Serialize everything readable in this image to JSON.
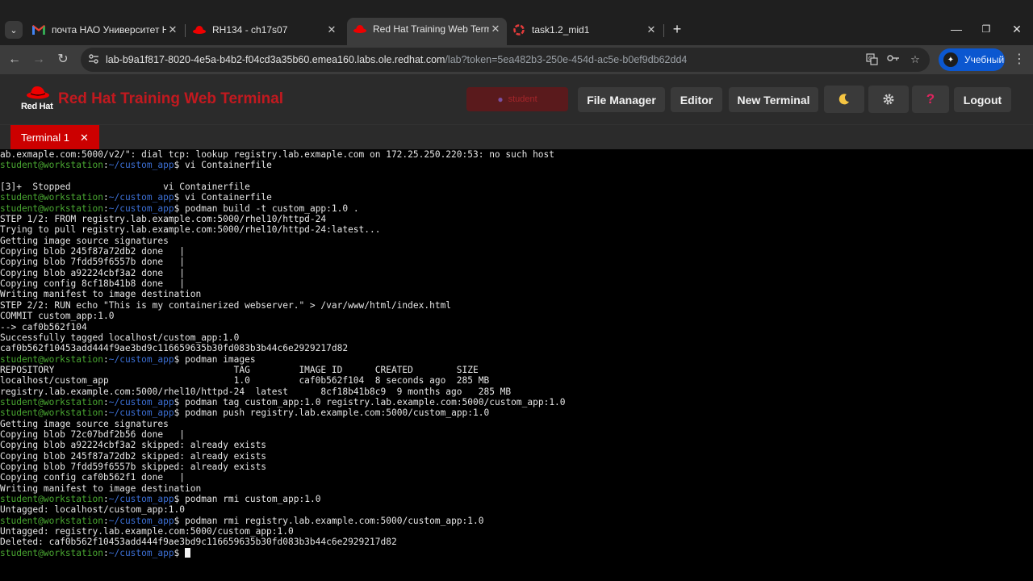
{
  "browser": {
    "tabs": [
      {
        "title": "почта НАО Университет НАРХ",
        "icon": "gmail-icon",
        "active": false
      },
      {
        "title": "RH134 - ch17s07",
        "icon": "redhat-hat-icon",
        "active": false
      },
      {
        "title": "Red Hat Training Web Terminal",
        "icon": "redhat-hat-icon",
        "active": true
      },
      {
        "title": "task1.2_mid1",
        "icon": "openshift-icon",
        "active": false
      }
    ],
    "url_host": "lab-b9a1f817-8020-4e5a-b4b2-f04cd3a35b60.emea160.labs.ole.redhat.com",
    "url_rest": "/lab?token=5ea482b3-250e-454d-ac5e-b0ef9db62dd4",
    "profile_label": "Учебный",
    "colors": {
      "accent": "#0b57d0",
      "chrome_bg": "#1f1f1f",
      "toolbar_bg": "#3c3c3c"
    }
  },
  "app": {
    "logo_text": "Red Hat",
    "title": "Red Hat Training Web Terminal",
    "user_label": "student",
    "buttons": {
      "file_manager": "File Manager",
      "editor": "Editor",
      "new_terminal": "New Terminal",
      "logout": "Logout"
    },
    "icons": {
      "theme": "moon-icon",
      "settings": "gear-icon",
      "help": "question-icon"
    },
    "colors": {
      "brand_red": "#cc0000",
      "header_bg": "#2b2b2b",
      "button_bg": "#3a3a3a"
    }
  },
  "terminal": {
    "tab_label": "Terminal 1",
    "prompt": {
      "user": "student@workstation",
      "path": "~/custom_app",
      "symbol": "$"
    },
    "lines": [
      {
        "text": "ab.exmaple.com:5000/v2/\": dial tcp: lookup registry.lab.exmaple.com on 172.25.250.220:53: no such host"
      },
      {
        "prompt": true,
        "cmd": " vi Containerfile"
      },
      {
        "text": ""
      },
      {
        "text": "[3]+  Stopped                 vi Containerfile"
      },
      {
        "prompt": true,
        "cmd": " vi Containerfile"
      },
      {
        "prompt": true,
        "cmd": " podman build -t custom_app:1.0 ."
      },
      {
        "text": "STEP 1/2: FROM registry.lab.example.com:5000/rhel10/httpd-24"
      },
      {
        "text": "Trying to pull registry.lab.example.com:5000/rhel10/httpd-24:latest..."
      },
      {
        "text": "Getting image source signatures"
      },
      {
        "text": "Copying blob 245f87a72db2 done   |"
      },
      {
        "text": "Copying blob 7fdd59f6557b done   |"
      },
      {
        "text": "Copying blob a92224cbf3a2 done   |"
      },
      {
        "text": "Copying config 8cf18b41b8 done   |"
      },
      {
        "text": "Writing manifest to image destination"
      },
      {
        "text": "STEP 2/2: RUN echo \"This is my containerized webserver.\" > /var/www/html/index.html"
      },
      {
        "text": "COMMIT custom_app:1.0"
      },
      {
        "text": "--> caf0b562f104"
      },
      {
        "text": "Successfully tagged localhost/custom_app:1.0"
      },
      {
        "text": "caf0b562f10453add444f9ae3bd9c116659635b30fd083b3b44c6e2929217d82"
      },
      {
        "prompt": true,
        "cmd": " podman images"
      },
      {
        "text": "REPOSITORY                                 TAG         IMAGE ID      CREATED        SIZE"
      },
      {
        "text": "localhost/custom_app                       1.0         caf0b562f104  8 seconds ago  285 MB"
      },
      {
        "text": "registry.lab.example.com:5000/rhel10/httpd-24  latest      8cf18b41b8c9  9 months ago   285 MB"
      },
      {
        "prompt": true,
        "cmd": " podman tag custom_app:1.0 registry.lab.example.com:5000/custom_app:1.0"
      },
      {
        "prompt": true,
        "cmd": " podman push registry.lab.example.com:5000/custom_app:1.0"
      },
      {
        "text": "Getting image source signatures"
      },
      {
        "text": "Copying blob 72c07bdf2b56 done   |"
      },
      {
        "text": "Copying blob a92224cbf3a2 skipped: already exists"
      },
      {
        "text": "Copying blob 245f87a72db2 skipped: already exists"
      },
      {
        "text": "Copying blob 7fdd59f6557b skipped: already exists"
      },
      {
        "text": "Copying config caf0b562f1 done   |"
      },
      {
        "text": "Writing manifest to image destination"
      },
      {
        "prompt": true,
        "cmd": " podman rmi custom_app:1.0"
      },
      {
        "text": "Untagged: localhost/custom_app:1.0"
      },
      {
        "prompt": true,
        "cmd": " podman rmi registry.lab.example.com:5000/custom_app:1.0"
      },
      {
        "text": "Untagged: registry.lab.example.com:5000/custom_app:1.0"
      },
      {
        "text": "Deleted: caf0b562f10453add444f9ae3bd9c116659635b30fd083b3b44c6e2929217d82"
      },
      {
        "prompt": true,
        "cmd": " ",
        "cursor": true
      }
    ],
    "colors": {
      "user": "#4aa832",
      "path": "#3c6fd4",
      "text": "#e6e6e6",
      "bg": "#000000"
    }
  }
}
